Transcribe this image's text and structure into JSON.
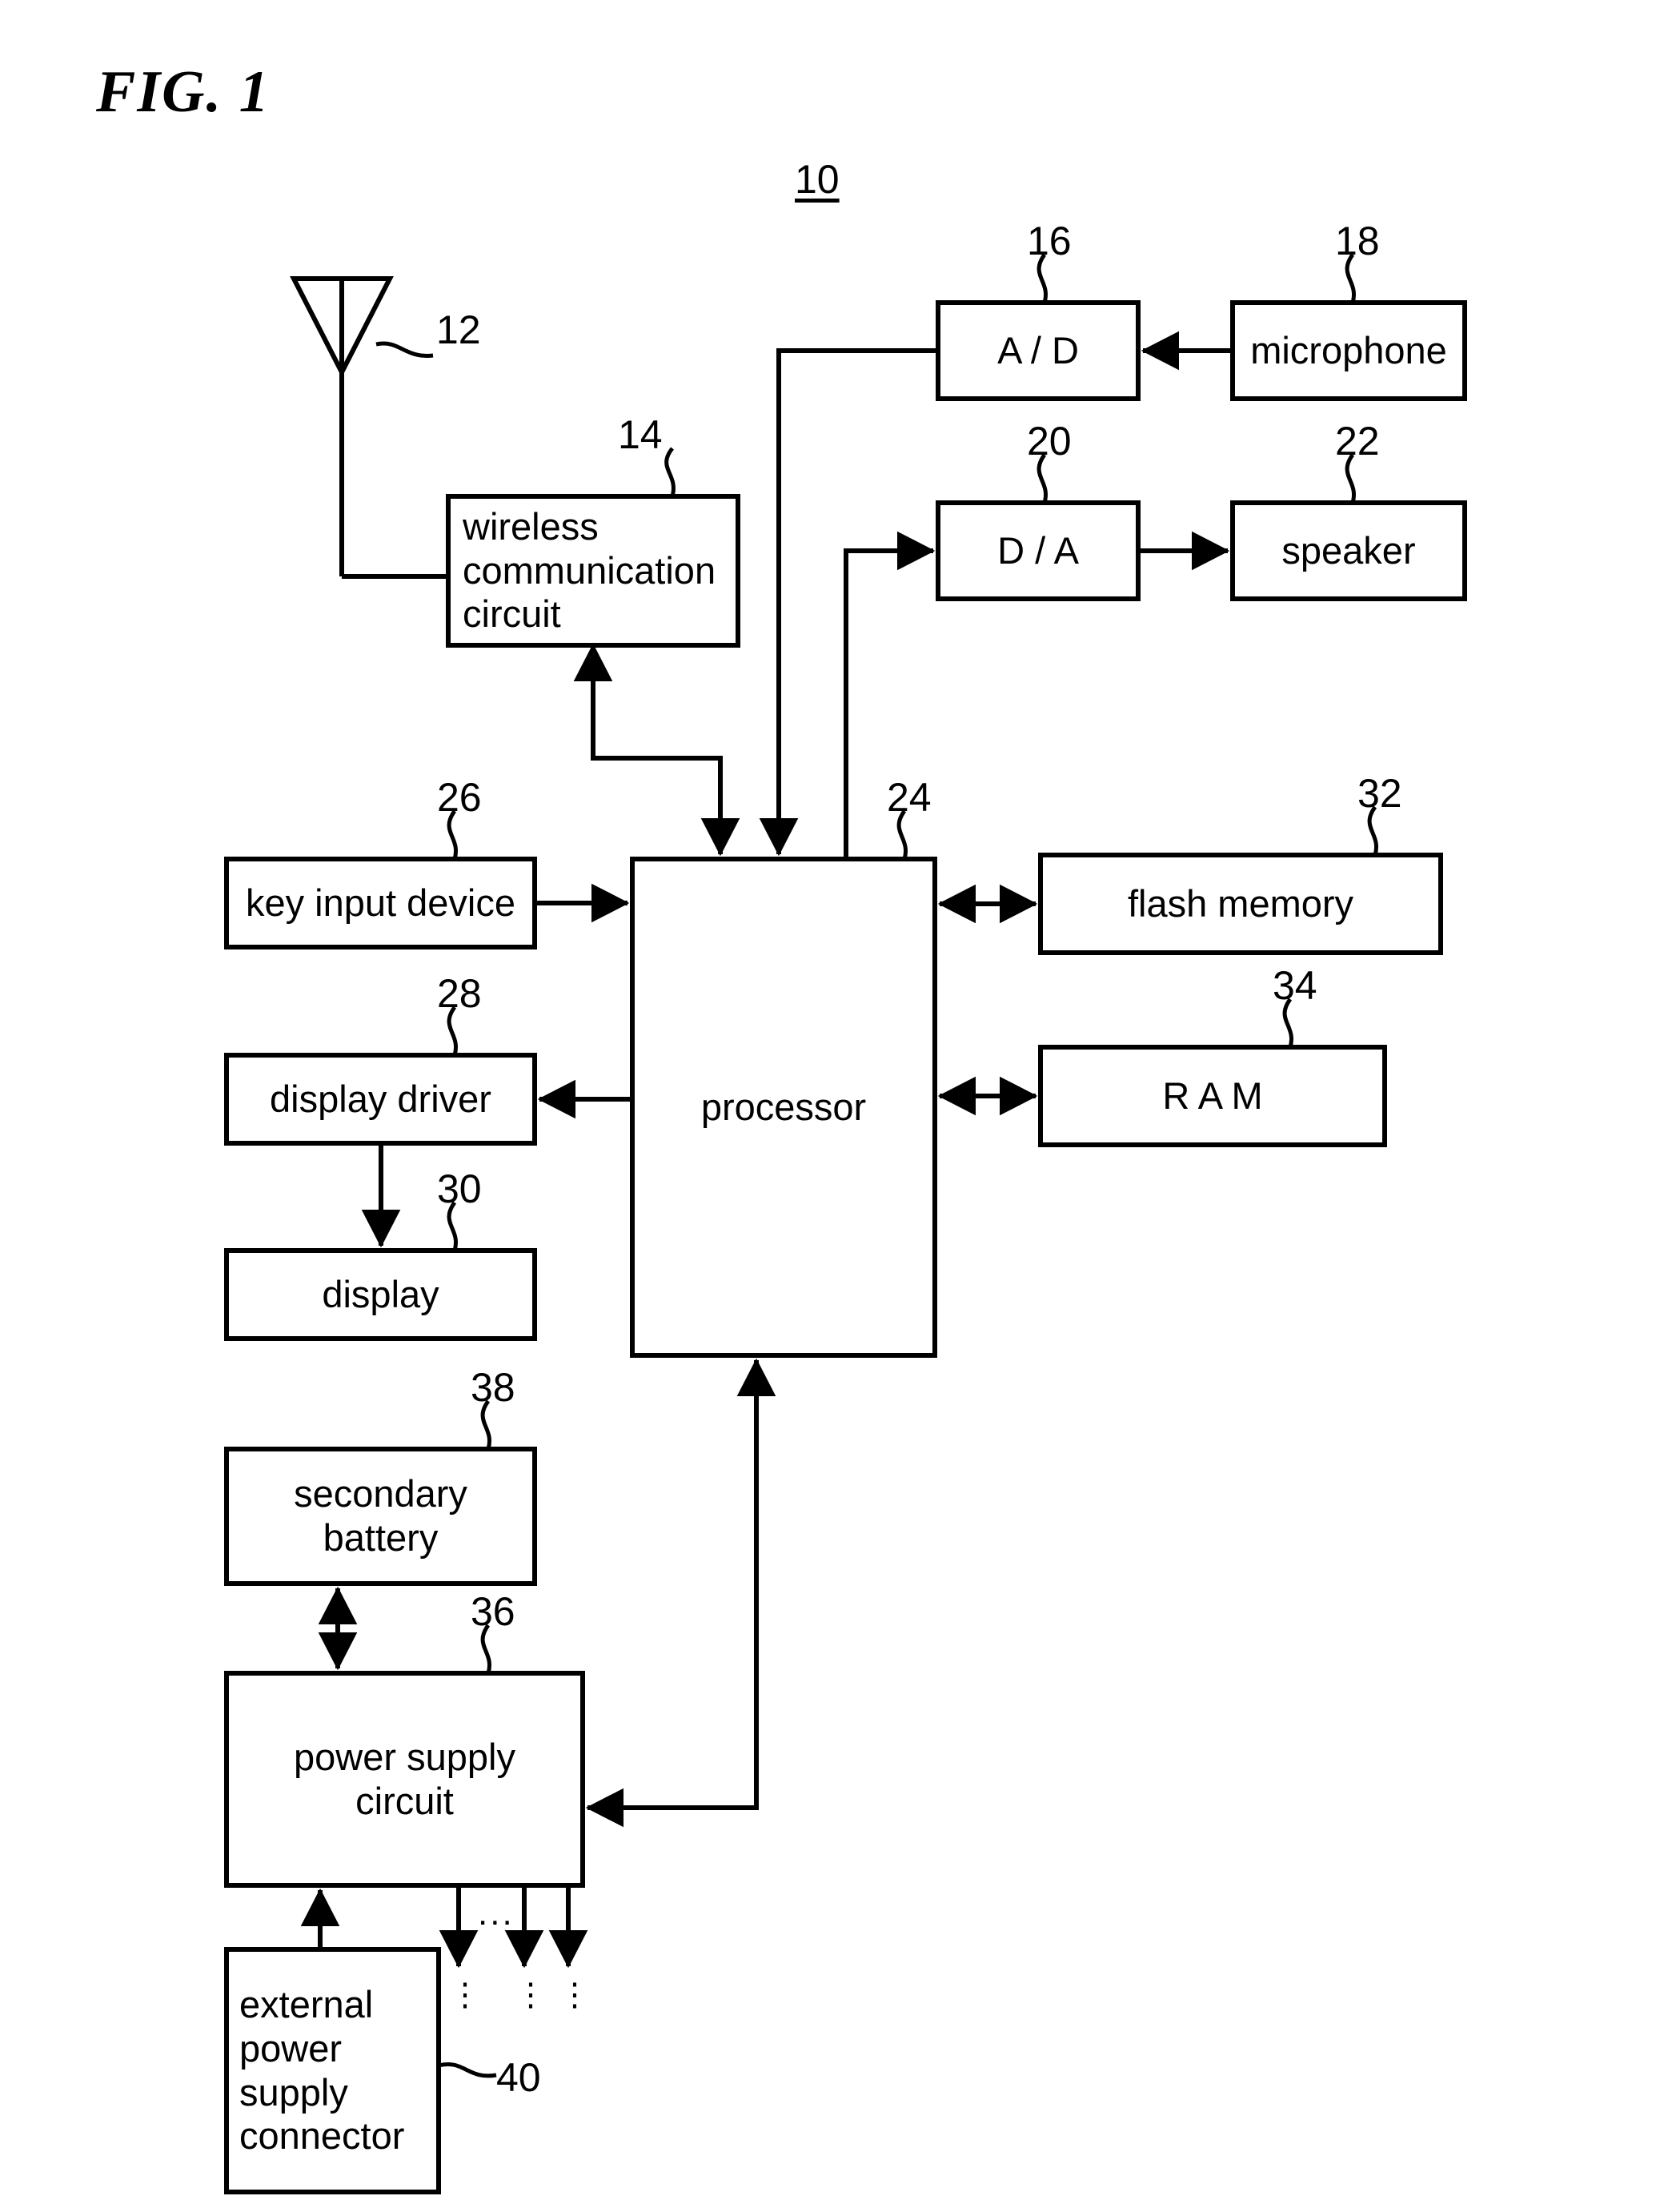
{
  "figure": {
    "title": "FIG. 1",
    "system_ref": "10"
  },
  "blocks": [
    {
      "id": "wireless_communication_circuit",
      "label": "wireless\ncommunication\ncircuit",
      "ref": "14",
      "align": "left"
    },
    {
      "id": "ad_converter",
      "label": "A / D",
      "ref": "16",
      "align": "center"
    },
    {
      "id": "microphone",
      "label": "microphone",
      "ref": "18",
      "align": "center"
    },
    {
      "id": "da_converter",
      "label": "D / A",
      "ref": "20",
      "align": "center"
    },
    {
      "id": "speaker",
      "label": "speaker",
      "ref": "22",
      "align": "center"
    },
    {
      "id": "processor",
      "label": "processor",
      "ref": "24",
      "align": "center"
    },
    {
      "id": "key_input_device",
      "label": "key input device",
      "ref": "26",
      "align": "center"
    },
    {
      "id": "display_driver",
      "label": "display driver",
      "ref": "28",
      "align": "center"
    },
    {
      "id": "display",
      "label": "display",
      "ref": "30",
      "align": "center"
    },
    {
      "id": "flash_memory",
      "label": "flash memory",
      "ref": "32",
      "align": "center"
    },
    {
      "id": "ram",
      "label": "R A M",
      "ref": "34",
      "align": "center"
    },
    {
      "id": "power_supply_circuit",
      "label": "power supply\ncircuit",
      "ref": "36",
      "align": "center"
    },
    {
      "id": "secondary_battery",
      "label": "secondary\nbattery",
      "ref": "38",
      "align": "center"
    },
    {
      "id": "external_power_supply_connector",
      "label": "external\npower\nsupply\nconnector",
      "ref": "40",
      "align": "left"
    }
  ],
  "antenna": {
    "ref": "12",
    "icon": "antenna-icon"
  },
  "markers": {
    "horizontal_ellipsis": "...",
    "vertical_ellipsis": "⋮"
  },
  "colors": {
    "stroke": "#000000",
    "background": "#ffffff"
  }
}
